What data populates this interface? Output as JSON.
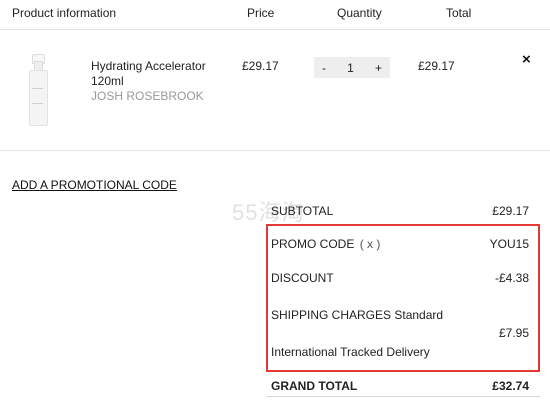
{
  "header": {
    "product_info": "Product information",
    "price": "Price",
    "quantity": "Quantity",
    "total": "Total"
  },
  "item": {
    "name_line1": "Hydrating Accelerator",
    "name_line2": "120ml",
    "brand": "JOSH ROSEBROOK",
    "price": "£29.17",
    "quantity": "1",
    "decrease": "-",
    "increase": "+",
    "total": "£29.17",
    "remove": "×"
  },
  "promo_link": "ADD A PROMOTIONAL CODE",
  "watermark": "55海淘",
  "summary": {
    "subtotal_label": "SUBTOTAL",
    "subtotal_value": "£29.17",
    "promo_label": "PROMO CODE",
    "promo_remove": "( x )",
    "promo_value": "YOU15",
    "discount_label": "DISCOUNT",
    "discount_value": "-£4.38",
    "shipping_label": "SHIPPING CHARGES",
    "shipping_method": "Standard",
    "shipping_method_line2": "International Tracked Delivery",
    "shipping_value": "£7.95",
    "grand_total_label": "GRAND TOTAL",
    "grand_total_value": "£32.74"
  },
  "colors": {
    "highlight_border": "#e53935",
    "brand_text": "#999999",
    "qty_bg": "#eeeeee"
  }
}
